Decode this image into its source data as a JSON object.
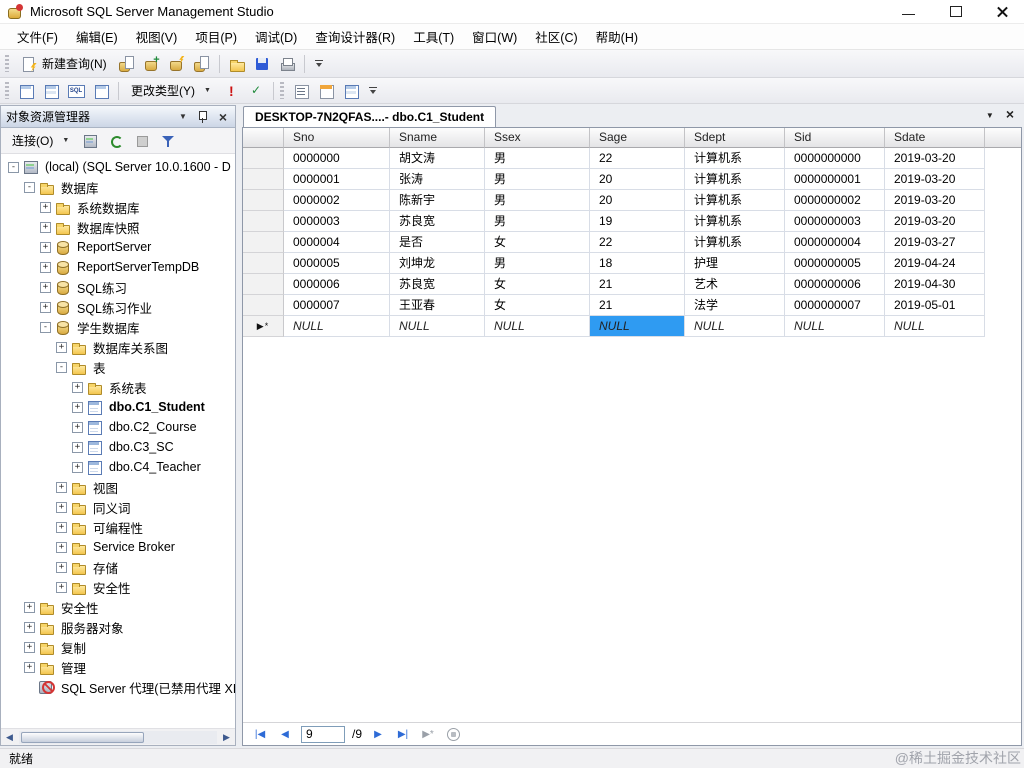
{
  "window": {
    "title": "Microsoft SQL Server Management Studio"
  },
  "menu": {
    "items": [
      "文件(F)",
      "编辑(E)",
      "视图(V)",
      "项目(P)",
      "调试(D)",
      "查询设计器(R)",
      "工具(T)",
      "窗口(W)",
      "社区(C)",
      "帮助(H)"
    ]
  },
  "toolbar_standard": {
    "new_query_label": "新建查询(N)"
  },
  "toolbar_query": {
    "change_type_label": "更改类型(Y)"
  },
  "object_explorer": {
    "title": "对象资源管理器",
    "connect_label": "连接(O)",
    "tree": [
      {
        "level": 0,
        "expander": "-",
        "icon": "server",
        "label": "(local) (SQL Server 10.0.1600 - D"
      },
      {
        "level": 1,
        "expander": "-",
        "icon": "folder",
        "label": "数据库"
      },
      {
        "level": 2,
        "expander": "+",
        "icon": "folder",
        "label": "系统数据库"
      },
      {
        "level": 2,
        "expander": "+",
        "icon": "folder",
        "label": "数据库快照"
      },
      {
        "level": 2,
        "expander": "+",
        "icon": "db",
        "label": "ReportServer"
      },
      {
        "level": 2,
        "expander": "+",
        "icon": "db",
        "label": "ReportServerTempDB"
      },
      {
        "level": 2,
        "expander": "+",
        "icon": "db",
        "label": "SQL练习"
      },
      {
        "level": 2,
        "expander": "+",
        "icon": "db",
        "label": "SQL练习作业"
      },
      {
        "level": 2,
        "expander": "-",
        "icon": "db",
        "label": "学生数据库"
      },
      {
        "level": 3,
        "expander": "+",
        "icon": "folder",
        "label": "数据库关系图"
      },
      {
        "level": 3,
        "expander": "-",
        "icon": "folder",
        "label": "表"
      },
      {
        "level": 4,
        "expander": "+",
        "icon": "folder",
        "label": "系统表"
      },
      {
        "level": 4,
        "expander": "+",
        "icon": "table",
        "label": "dbo.C1_Student",
        "bold": true
      },
      {
        "level": 4,
        "expander": "+",
        "icon": "table",
        "label": "dbo.C2_Course"
      },
      {
        "level": 4,
        "expander": "+",
        "icon": "table",
        "label": "dbo.C3_SC"
      },
      {
        "level": 4,
        "expander": "+",
        "icon": "table",
        "label": "dbo.C4_Teacher"
      },
      {
        "level": 3,
        "expander": "+",
        "icon": "folder",
        "label": "视图"
      },
      {
        "level": 3,
        "expander": "+",
        "icon": "folder",
        "label": "同义词"
      },
      {
        "level": 3,
        "expander": "+",
        "icon": "folder",
        "label": "可编程性"
      },
      {
        "level": 3,
        "expander": "+",
        "icon": "folder",
        "label": "Service Broker"
      },
      {
        "level": 3,
        "expander": "+",
        "icon": "folder",
        "label": "存储"
      },
      {
        "level": 3,
        "expander": "+",
        "icon": "folder",
        "label": "安全性"
      },
      {
        "level": 1,
        "expander": "+",
        "icon": "folder",
        "label": "安全性"
      },
      {
        "level": 1,
        "expander": "+",
        "icon": "folder",
        "label": "服务器对象"
      },
      {
        "level": 1,
        "expander": "+",
        "icon": "folder",
        "label": "复制"
      },
      {
        "level": 1,
        "expander": "+",
        "icon": "folder",
        "label": "管理"
      },
      {
        "level": 1,
        "expander": "",
        "icon": "agent",
        "label": "SQL Server 代理(已禁用代理 XI"
      }
    ]
  },
  "document": {
    "tab_title": "DESKTOP-7N2QFAS....- dbo.C1_Student",
    "grid": {
      "columns": [
        "Sno",
        "Sname",
        "Ssex",
        "Sage",
        "Sdept",
        "Sid",
        "Sdate"
      ],
      "rows": [
        [
          "0000000",
          "胡文涛",
          "男",
          "22",
          "计算机系",
          "0000000000",
          "2019-03-20"
        ],
        [
          "0000001",
          "张涛",
          "男",
          "20",
          "计算机系",
          "0000000001",
          "2019-03-20"
        ],
        [
          "0000002",
          "陈新宇",
          "男",
          "20",
          "计算机系",
          "0000000002",
          "2019-03-20"
        ],
        [
          "0000003",
          "苏良宽",
          "男",
          "19",
          "计算机系",
          "0000000003",
          "2019-03-20"
        ],
        [
          "0000004",
          "是否",
          "女",
          "22",
          "计算机系",
          "0000000004",
          "2019-03-27"
        ],
        [
          "0000005",
          "刘坤龙",
          "男",
          "18",
          "护理",
          "0000000005",
          "2019-04-24"
        ],
        [
          "0000006",
          "苏良宽",
          "女",
          "21",
          "艺术",
          "0000000006",
          "2019-04-30"
        ],
        [
          "0000007",
          "王亚春",
          "女",
          "21",
          "法学",
          "0000000007",
          "2019-05-01"
        ]
      ],
      "new_row": {
        "values": [
          "NULL",
          "NULL",
          "NULL",
          "NULL",
          "NULL",
          "NULL",
          "NULL"
        ],
        "selected_col": 3
      }
    },
    "pager": {
      "position": "9",
      "of_label": "/9"
    }
  },
  "status_bar": {
    "ready_label": "就绪"
  },
  "watermark": "@稀土掘金技术社区",
  "colors": {
    "selection": "#2f9bf2",
    "accent_red": "#d43535",
    "folder_yellow": "#f3c64e"
  }
}
